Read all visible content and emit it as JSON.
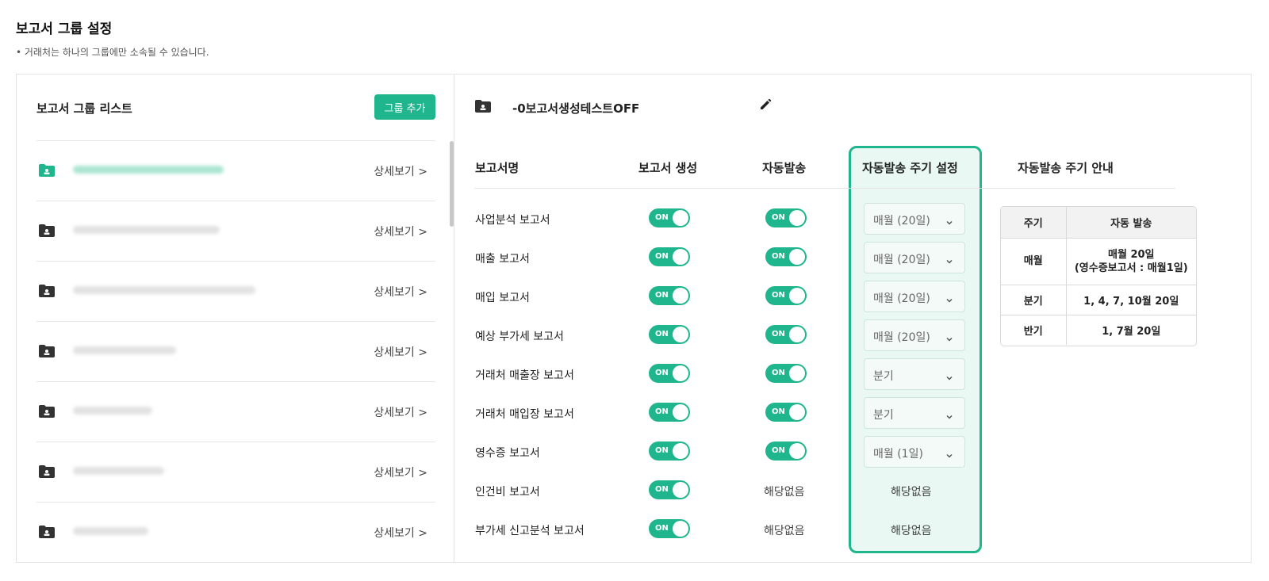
{
  "page": {
    "title": "보고서 그룹 설정",
    "note": "• 거래처는 하나의 그룹에만 소속될 수 있습니다."
  },
  "sidebar": {
    "title": "보고서 그룹 리스트",
    "add_button": "그룹 추가",
    "detail_label": "상세보기 >",
    "items": [
      {
        "active": true
      },
      {
        "active": false
      },
      {
        "active": false
      },
      {
        "active": false
      },
      {
        "active": false
      },
      {
        "active": false
      },
      {
        "active": false
      }
    ]
  },
  "group": {
    "name": "-0보고서생성테스트OFF"
  },
  "table": {
    "headers": {
      "name": "보고서명",
      "create": "보고서 생성",
      "auto_send": "자동발송",
      "cycle_setting": "자동발송 주기 설정",
      "cycle_guide": "자동발송 주기 안내"
    },
    "toggle_label": "ON",
    "rows": [
      {
        "name": "사업분석 보고서",
        "cycle": "매월 (20일)"
      },
      {
        "name": "매출 보고서",
        "cycle": "매월 (20일)"
      },
      {
        "name": "매입 보고서",
        "cycle": "매월 (20일)"
      },
      {
        "name": "예상 부가세 보고서",
        "cycle": "매월 (20일)"
      },
      {
        "name": "거래처 매출장 보고서",
        "cycle": "분기"
      },
      {
        "name": "거래처 매입장 보고서",
        "cycle": "분기"
      },
      {
        "name": "영수증 보고서",
        "cycle": "매월 (1일)"
      },
      {
        "name": "인건비 보고서",
        "auto_send": "해당없음",
        "cycle": "해당없음"
      },
      {
        "name": "부가세 신고분석 보고서",
        "auto_send": "해당없음",
        "cycle": "해당없음"
      }
    ]
  },
  "guide": {
    "headers": [
      "주기",
      "자동 발송"
    ],
    "rows": [
      {
        "period": "매월",
        "send_line1": "매월 20일",
        "send_line2": "(영수증보고서 : 매월1일)"
      },
      {
        "period": "분기",
        "send_line1": "1, 4, 7, 10월 20일"
      },
      {
        "period": "반기",
        "send_line1": "1, 7월 20일"
      }
    ]
  },
  "colors": {
    "accent": "#1fb58d",
    "highlight_bg": "#e9f8f2"
  }
}
